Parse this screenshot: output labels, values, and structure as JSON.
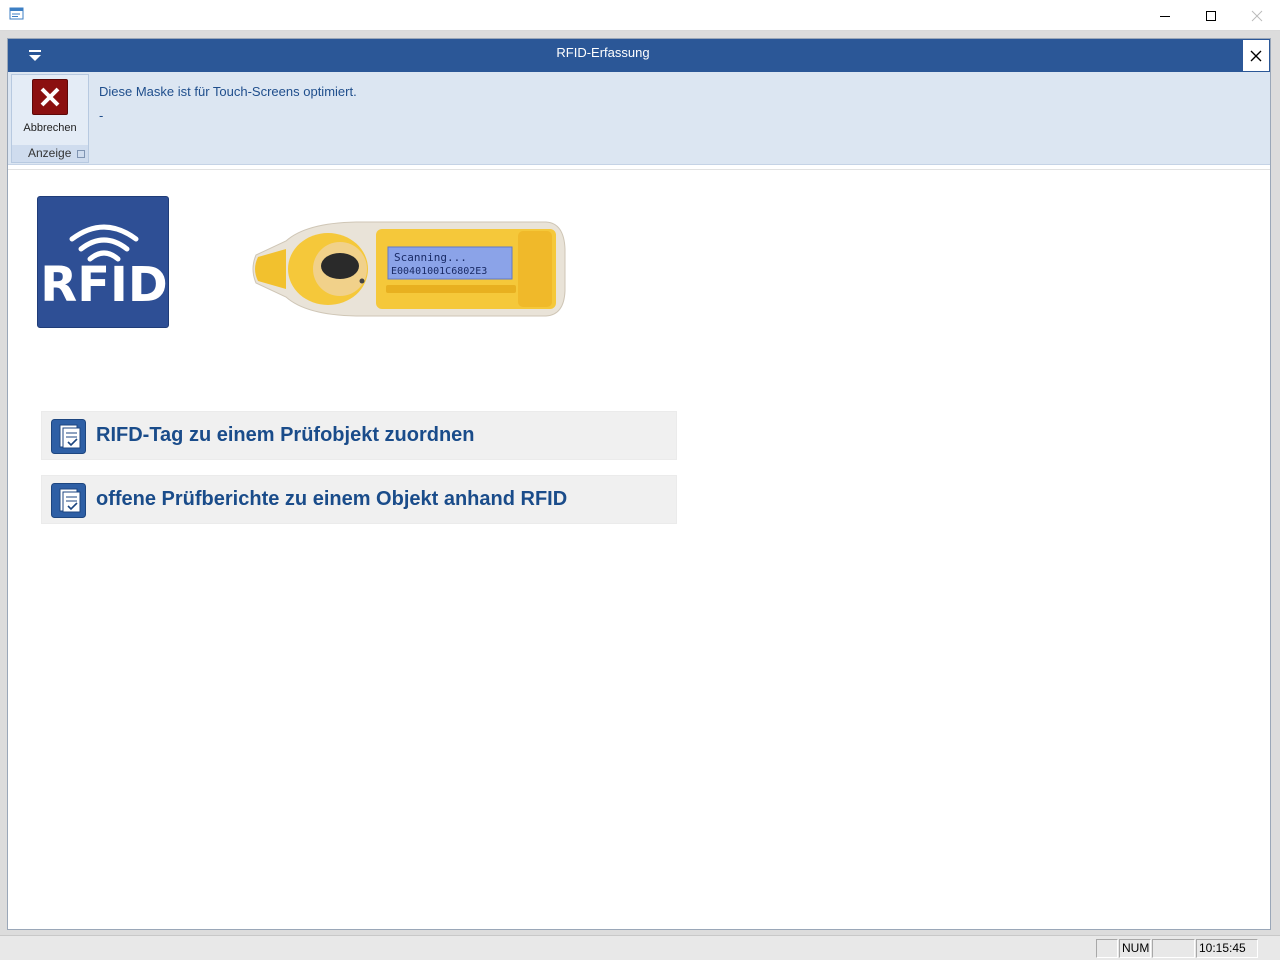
{
  "window": {
    "controls": {
      "minimize": "minimize",
      "maximize": "maximize",
      "close": "close"
    }
  },
  "frame": {
    "title": "RFID-Erfassung"
  },
  "ribbon": {
    "cancel_label": "Abbrechen",
    "group_label": "Anzeige",
    "info_line1": "Diese Maske ist für Touch-Screens optimiert.",
    "info_line2": "-"
  },
  "logo": {
    "text": "RFID"
  },
  "scanner": {
    "screen_line1": "Scanning...",
    "screen_line2": "E00401001C6802E3"
  },
  "actions": [
    {
      "label": "RIFD-Tag zu einem Prüfobjekt zuordnen",
      "icon": "report-icon"
    },
    {
      "label": "offene Prüfberichte zu einem Objekt anhand RFID",
      "icon": "report-icon"
    }
  ],
  "statusbar": {
    "cell1": "",
    "num": "NUM",
    "cell3": "",
    "time": "10:15:45"
  },
  "colors": {
    "header": "#2b5797",
    "ribbon": "#dce6f2",
    "accent_text": "#1a4c8a",
    "cancel": "#8b1010"
  }
}
